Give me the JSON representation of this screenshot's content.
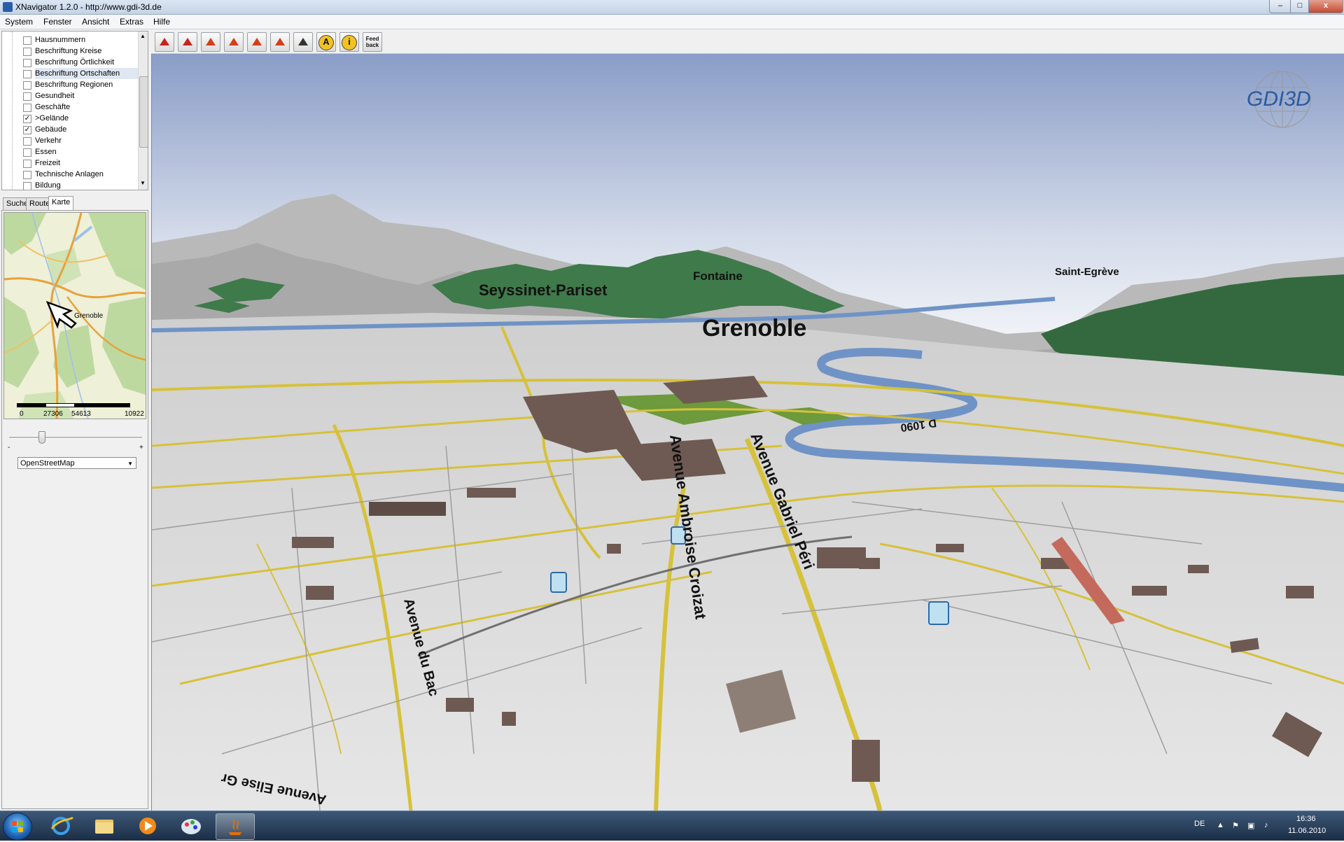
{
  "window": {
    "title": "XNavigator 1.2.0 - http://www.gdi-3d.de",
    "close_symbol": "x"
  },
  "menu": [
    "System",
    "Fenster",
    "Ansicht",
    "Extras",
    "Hilfe"
  ],
  "layers": [
    {
      "label": "Hausnummern",
      "checked": false
    },
    {
      "label": "Beschriftung Kreise",
      "checked": false
    },
    {
      "label": "Beschriftung Örtlichkeit",
      "checked": false
    },
    {
      "label": "Beschriftung Ortschaften",
      "checked": false,
      "selected": true
    },
    {
      "label": "Beschriftung Regionen",
      "checked": false
    },
    {
      "label": "Gesundheit",
      "checked": false
    },
    {
      "label": "Geschäfte",
      "checked": false
    },
    {
      "label": ">Gelände",
      "checked": true
    },
    {
      "label": "Gebäude",
      "checked": true
    },
    {
      "label": "Verkehr",
      "checked": false
    },
    {
      "label": "Essen",
      "checked": false
    },
    {
      "label": "Freizeit",
      "checked": false
    },
    {
      "label": "Technische Anlagen",
      "checked": false
    },
    {
      "label": "Bildung",
      "checked": false
    }
  ],
  "tabs": [
    {
      "label": "Suche",
      "active": false
    },
    {
      "label": "Route",
      "active": false
    },
    {
      "label": "Karte",
      "active": true
    }
  ],
  "minimap": {
    "place_label": "Grenoble",
    "scale_labels": [
      "0",
      "27306",
      "54613",
      "10922"
    ]
  },
  "zoom": {
    "minus": "-",
    "plus": "+",
    "level": 0.23
  },
  "map_source": "OpenStreetMap",
  "toolbar": {
    "tools": [
      {
        "name": "fly-icon",
        "glyph": ""
      },
      {
        "name": "turn-icon",
        "glyph": ""
      },
      {
        "name": "move-updown-icon",
        "glyph": ""
      },
      {
        "name": "move-icon",
        "glyph": ""
      },
      {
        "name": "rotate-icon",
        "glyph": ""
      },
      {
        "name": "undo-icon",
        "glyph": ""
      },
      {
        "name": "hand-icon",
        "glyph": ""
      },
      {
        "name": "label-a-icon",
        "glyph": "A"
      },
      {
        "name": "info-icon",
        "glyph": "i"
      },
      {
        "name": "feedback-icon",
        "glyph": "Feed back"
      }
    ]
  },
  "scene": {
    "place_labels": [
      {
        "text": "Seyssinet-Pariset",
        "size": 22
      },
      {
        "text": "Fontaine",
        "size": 17
      },
      {
        "text": "Grenoble",
        "size": 34
      },
      {
        "text": "Saint-Egrève",
        "size": 15
      }
    ],
    "street_labels": [
      "Avenue Ambroise Croizat",
      "Avenue Gabriel Péri",
      "Avenue du Bac",
      "Avenue Elise Gr",
      "D 1090"
    ],
    "logo_text": "GDI3D"
  },
  "taskbar": {
    "language": "DE",
    "time": "16:36",
    "date": "11.06.2010"
  },
  "colors": {
    "sky_top": "#8a9dc8",
    "sky_horizon": "#ffffff",
    "terrain": "#d9d9d9",
    "forest": "#3f7a4a",
    "road": "#d6c13a",
    "river": "#6f93c6",
    "park": "#6c9a3c"
  }
}
